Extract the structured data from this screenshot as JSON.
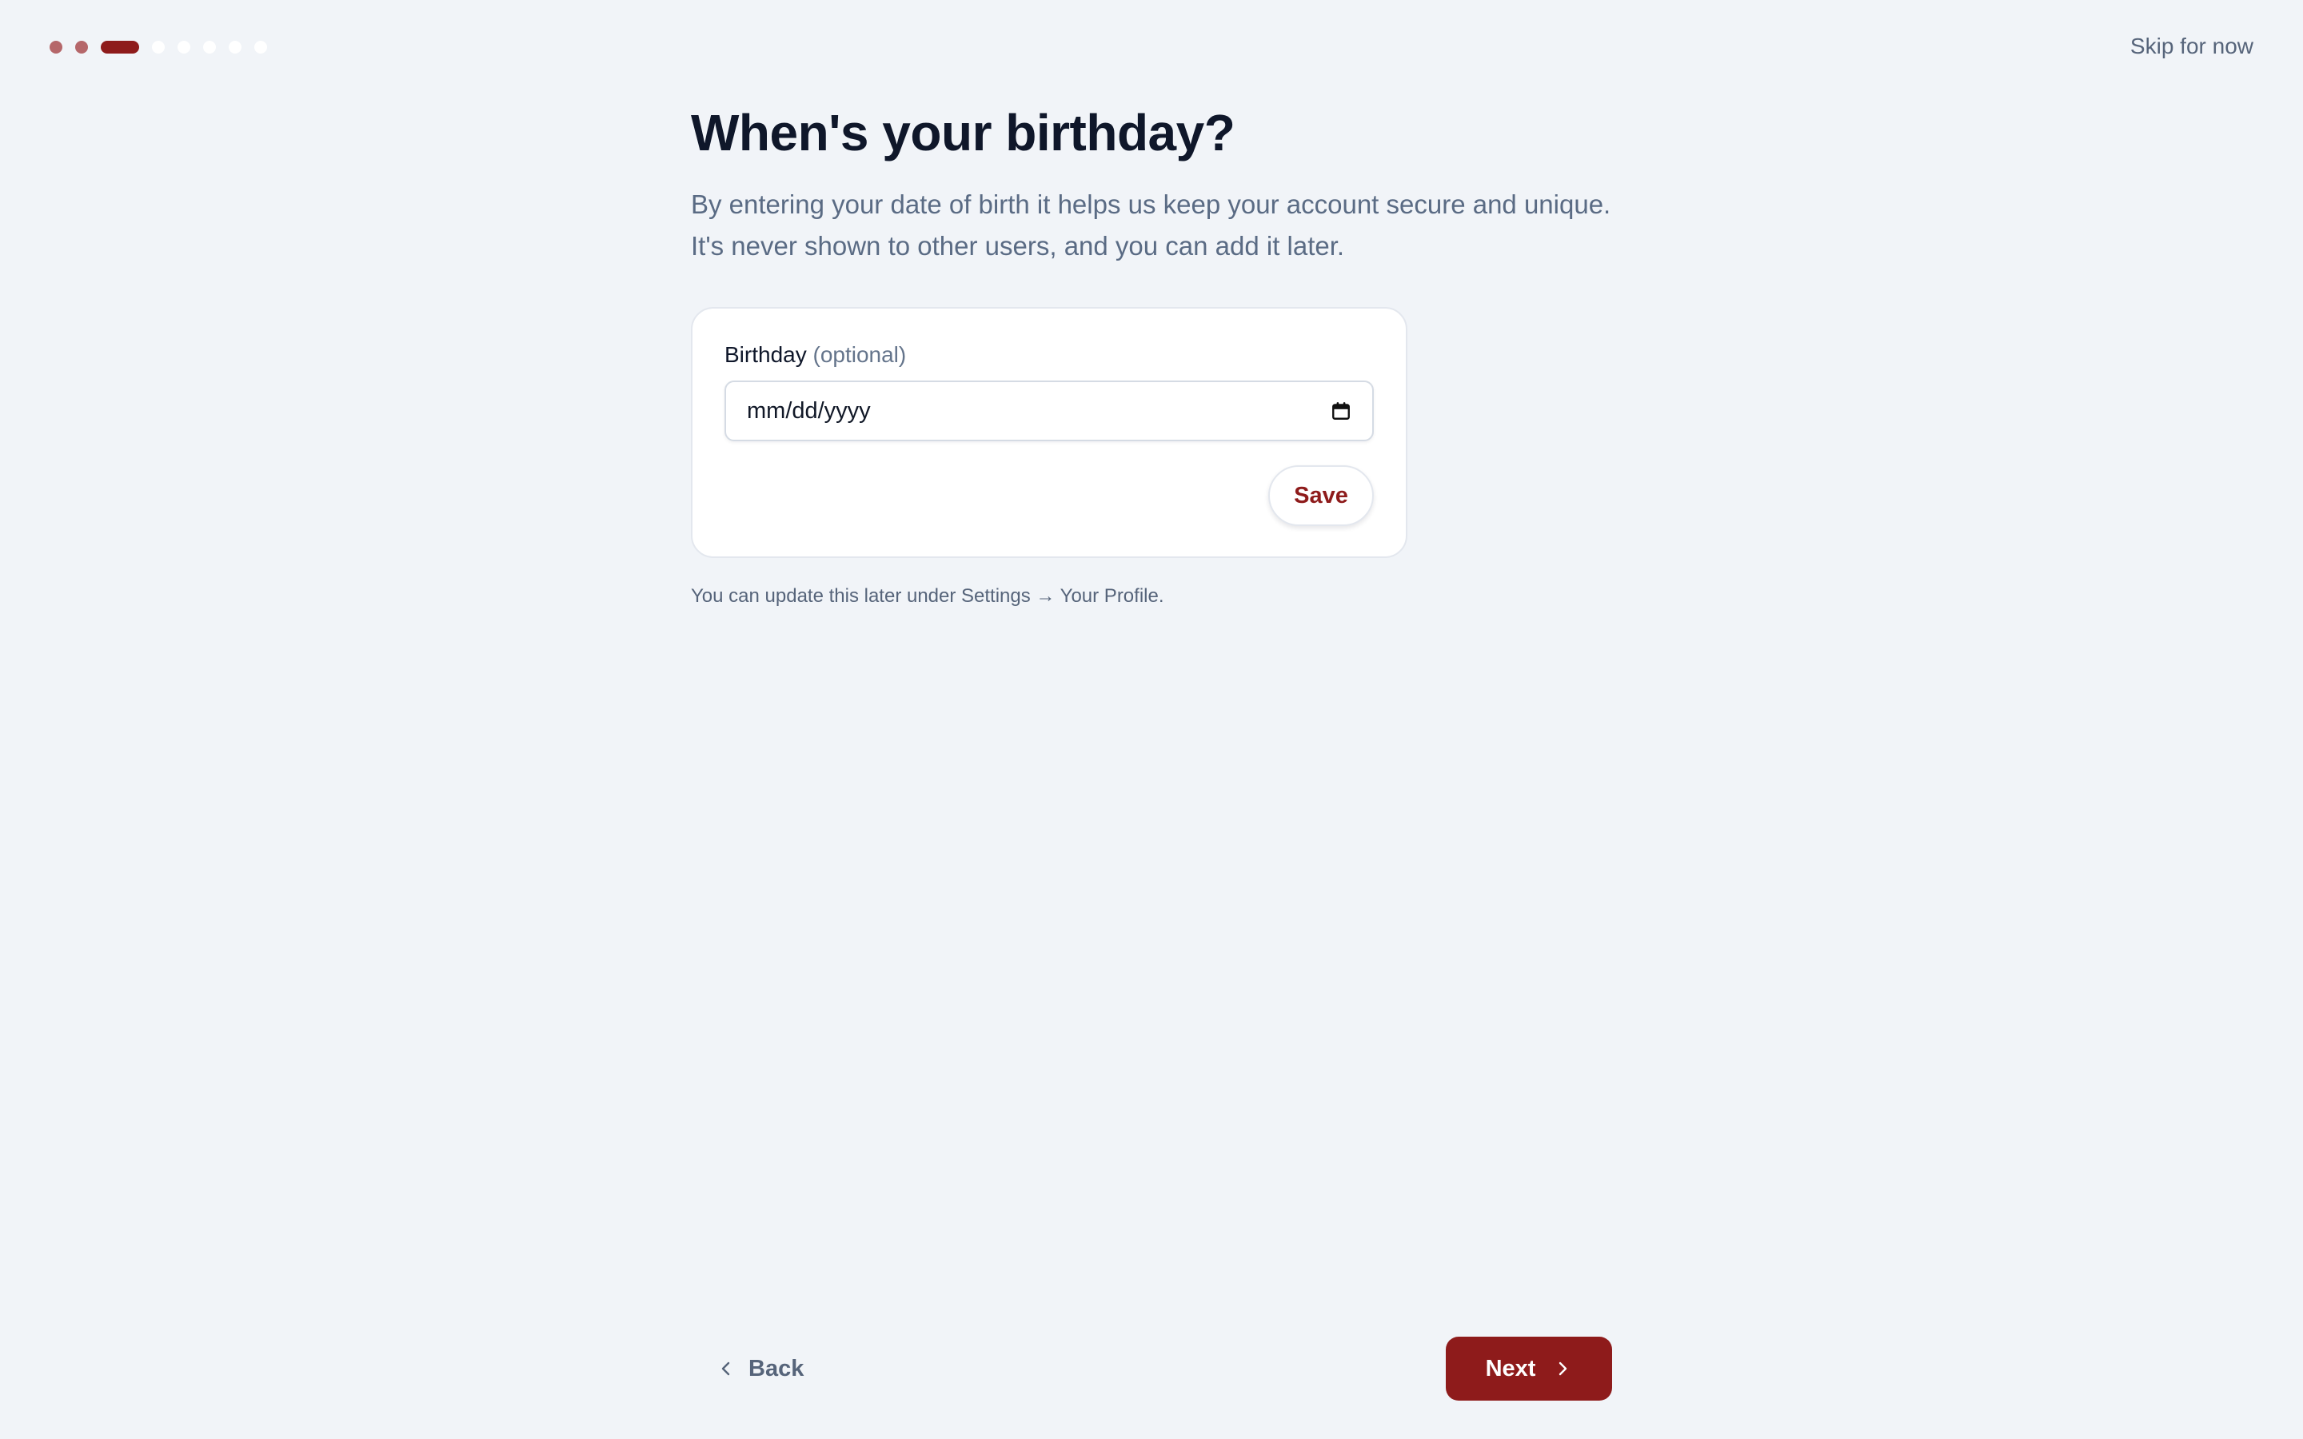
{
  "progress": {
    "total_steps": 9,
    "completed_steps": 2,
    "current_step": 3,
    "colors": {
      "done": "#b5676a",
      "current": "#8e1b1b",
      "upcoming": "#ffffff"
    }
  },
  "header": {
    "skip_label": "Skip for now"
  },
  "main": {
    "title": "When's your birthday?",
    "description_line1": "By entering your date of birth it helps us keep your account secure and unique.",
    "description_line2": "It's never shown to other users, and you can add it later."
  },
  "birthday_card": {
    "label": "Birthday",
    "label_optional": "(optional)",
    "input_value": "mm/dd/yyyy",
    "input_icon": "calendar-icon",
    "save_label": "Save"
  },
  "hint": "You can update this later under Settings → Your Profile.",
  "footer": {
    "back_label": "Back",
    "next_label": "Next",
    "accent_color": "#8e1b1b"
  }
}
